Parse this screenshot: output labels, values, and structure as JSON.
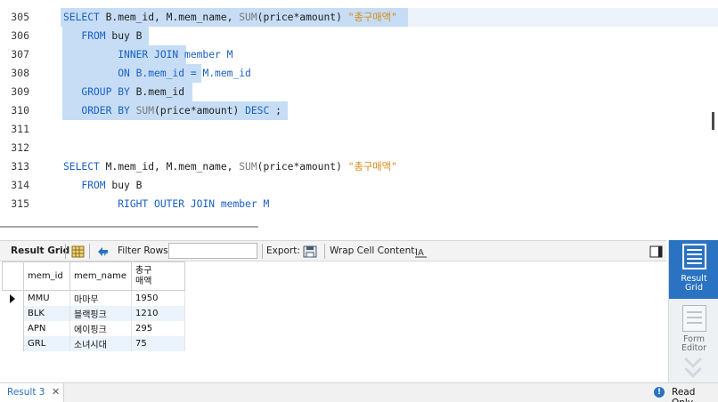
{
  "editor": {
    "lines": [
      {
        "num": "305",
        "selected": true,
        "tokens": [
          {
            "t": "SELECT ",
            "c": "kw"
          },
          {
            "t": "B.mem_id, M.mem_name, ",
            "c": "plain"
          },
          {
            "t": "SUM",
            "c": "fn"
          },
          {
            "t": "(price*amount) ",
            "c": "plain"
          },
          {
            "t": "\"총구매액\"",
            "c": "str"
          }
        ]
      },
      {
        "num": "306",
        "selected": true,
        "tokens": [
          {
            "t": "   FROM ",
            "c": "kw"
          },
          {
            "t": "buy B",
            "c": "plain"
          }
        ]
      },
      {
        "num": "307",
        "selected": true,
        "tokens": [
          {
            "t": "         INNER JOIN ",
            "c": "kw"
          },
          {
            "t": "member M",
            "c": "kw"
          }
        ]
      },
      {
        "num": "308",
        "selected": true,
        "tokens": [
          {
            "t": "         ON ",
            "c": "kw"
          },
          {
            "t": "B.mem_id = M.mem_id",
            "c": "kw"
          }
        ]
      },
      {
        "num": "309",
        "selected": true,
        "tokens": [
          {
            "t": "   GROUP BY ",
            "c": "kw"
          },
          {
            "t": "B.mem_id",
            "c": "plain"
          }
        ]
      },
      {
        "num": "310",
        "selected": true,
        "tokens": [
          {
            "t": "   ORDER BY ",
            "c": "kw"
          },
          {
            "t": "SUM",
            "c": "fn"
          },
          {
            "t": "(price*amount) ",
            "c": "plain"
          },
          {
            "t": "DESC",
            "c": "kw"
          },
          {
            "t": " ;",
            "c": "plain"
          }
        ]
      },
      {
        "num": "311",
        "selected": false,
        "tokens": []
      },
      {
        "num": "312",
        "selected": false,
        "tokens": []
      },
      {
        "num": "313",
        "selected": false,
        "tokens": [
          {
            "t": "SELECT ",
            "c": "kw"
          },
          {
            "t": "M.mem_id, M.mem_name, ",
            "c": "plain"
          },
          {
            "t": "SUM",
            "c": "fn"
          },
          {
            "t": "(price*amount) ",
            "c": "plain"
          },
          {
            "t": "\"총구매액\"",
            "c": "str"
          }
        ]
      },
      {
        "num": "314",
        "selected": false,
        "tokens": [
          {
            "t": "   FROM ",
            "c": "kw"
          },
          {
            "t": "buy B",
            "c": "plain"
          }
        ]
      },
      {
        "num": "315",
        "selected": false,
        "tokens": [
          {
            "t": "         RIGHT OUTER JOIN ",
            "c": "kw"
          },
          {
            "t": "member M",
            "c": "kw"
          }
        ]
      }
    ]
  },
  "toolbar": {
    "result_grid_label": "Result Grid",
    "filter_rows_label": "Filter Rows:",
    "filter_value": "",
    "export_label": "Export:",
    "wrap_label": "Wrap Cell Content:"
  },
  "grid": {
    "columns": [
      "mem_id",
      "mem_name",
      "총구\n매액"
    ],
    "column_header_total_line1": "총구",
    "column_header_total_line2": "매액",
    "rows": [
      [
        "MMU",
        "마마무",
        "1950"
      ],
      [
        "BLK",
        "블랙핑크",
        "1210"
      ],
      [
        "APN",
        "에이핑크",
        "295"
      ],
      [
        "GRL",
        "소녀시대",
        "75"
      ]
    ]
  },
  "side_panel": {
    "result_grid_line1": "Result",
    "result_grid_line2": "Grid",
    "form_editor_line1": "Form",
    "form_editor_line2": "Editor"
  },
  "bottom": {
    "tab_label": "Result 3",
    "tab_close": "✕",
    "status": "Read Only"
  },
  "colors": {
    "keyword": "#1a5fc4",
    "string": "#d88a1a",
    "selection": "#c6ddf5",
    "accent": "#2a72c2"
  }
}
